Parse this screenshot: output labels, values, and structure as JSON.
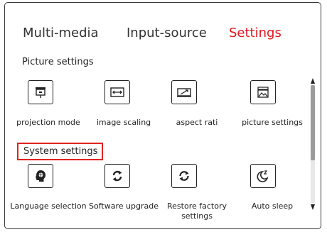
{
  "tabs": [
    {
      "label": "Multi-media"
    },
    {
      "label": "Input-source"
    },
    {
      "label": "Settings",
      "active": true
    }
  ],
  "picture_settings": {
    "title": "Picture settings",
    "items": [
      {
        "label": "projection mode",
        "icon": "projector-icon"
      },
      {
        "label": "image scaling",
        "icon": "image-scaling-icon"
      },
      {
        "label": "aspect rati",
        "icon": "aspect-ratio-icon"
      },
      {
        "label": "picture settings",
        "icon": "picture-icon"
      }
    ]
  },
  "system_settings": {
    "title": "System settings",
    "items": [
      {
        "label": "Language selection",
        "icon": "globe-icon"
      },
      {
        "label": "Software upgrade",
        "icon": "refresh-icon"
      },
      {
        "label": "Restore factory settings",
        "icon": "restore-icon"
      },
      {
        "label": "Auto sleep",
        "icon": "moon-sleep-icon"
      }
    ]
  },
  "colors": {
    "active_tab": "#e0181f",
    "highlight_border": "#e0241f"
  }
}
